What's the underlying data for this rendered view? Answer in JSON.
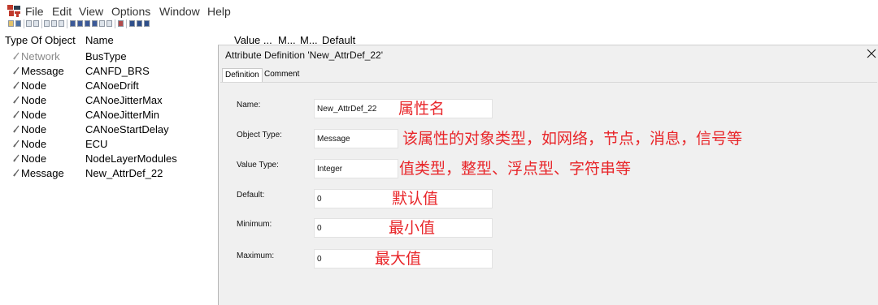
{
  "menu": {
    "items": [
      "File",
      "Edit",
      "View",
      "Options",
      "Window",
      "Help"
    ]
  },
  "list": {
    "headers": {
      "type_of_object": "Type Of Object",
      "name": "Name",
      "value": "Value ...",
      "m1": "M...",
      "m2": "M...",
      "default": "Default"
    },
    "rows": [
      {
        "type": "Network",
        "name": "BusType"
      },
      {
        "type": "Message",
        "name": "CANFD_BRS"
      },
      {
        "type": "Node",
        "name": "CANoeDrift"
      },
      {
        "type": "Node",
        "name": "CANoeJitterMax"
      },
      {
        "type": "Node",
        "name": "CANoeJitterMin"
      },
      {
        "type": "Node",
        "name": "CANoeStartDelay"
      },
      {
        "type": "Node",
        "name": "ECU"
      },
      {
        "type": "Node",
        "name": "NodeLayerModules"
      },
      {
        "type": "Message",
        "name": "New_AttrDef_22"
      }
    ]
  },
  "dialog": {
    "title": "Attribute Definition 'New_AttrDef_22'",
    "tabs": [
      "Definition",
      "Comment"
    ],
    "active_tab": "Definition",
    "fields": {
      "name": {
        "label": "Name:",
        "value": "New_AttrDef_22",
        "annotation": "属性名"
      },
      "object_type": {
        "label": "Object Type:",
        "value": "Message",
        "annotation": "该属性的对象类型，如网络，节点，消息，信号等"
      },
      "value_type": {
        "label": "Value Type:",
        "value": "Integer",
        "annotation": "值类型，整型、浮点型、字符串等"
      },
      "default": {
        "label": "Default:",
        "value": "0",
        "annotation": "默认值"
      },
      "minimum": {
        "label": "Minimum:",
        "value": "0",
        "annotation": "最小值"
      },
      "maximum": {
        "label": "Maximum:",
        "value": "0",
        "annotation": "最大值"
      }
    }
  },
  "colors": {
    "annotation": "#e8262a",
    "dialog_bg": "#f0f0f0"
  }
}
